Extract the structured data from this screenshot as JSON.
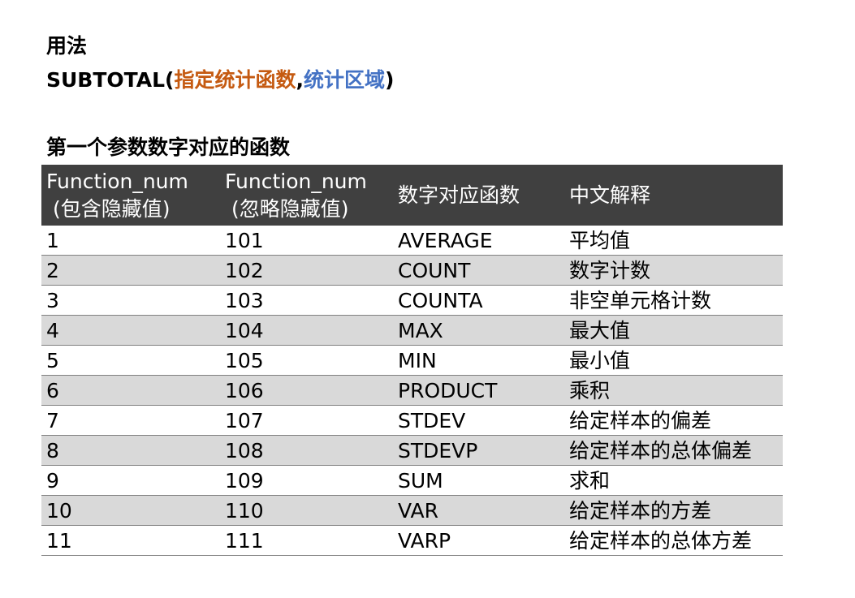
{
  "usage_heading": "用法",
  "syntax": {
    "func_name": "SUBTOTAL(",
    "arg1": "指定统计函数",
    "separator": ",",
    "arg2": "统计区域",
    "close": ")",
    "colors": {
      "arg1": "#C55A11",
      "arg2": "#4472C4"
    }
  },
  "section_title": "第一个参数数字对应的函数",
  "table": {
    "header_bg": "#404040",
    "alt_row_bg": "#D9D9D9",
    "columns": [
      {
        "line1": "Function_num",
        "line2": "(包含隐藏值)"
      },
      {
        "line1": "Function_num",
        "line2": "(忽略隐藏值)"
      },
      {
        "line1": "数字对应函数"
      },
      {
        "line1": "中文解释"
      }
    ],
    "rows": [
      {
        "num_incl": "1",
        "num_excl": "101",
        "func": "AVERAGE",
        "desc": "平均值"
      },
      {
        "num_incl": "2",
        "num_excl": "102",
        "func": "COUNT",
        "desc": "数字计数"
      },
      {
        "num_incl": "3",
        "num_excl": "103",
        "func": "COUNTA",
        "desc": "非空单元格计数"
      },
      {
        "num_incl": "4",
        "num_excl": "104",
        "func": "MAX",
        "desc": "最大值"
      },
      {
        "num_incl": "5",
        "num_excl": "105",
        "func": "MIN",
        "desc": "最小值"
      },
      {
        "num_incl": "6",
        "num_excl": "106",
        "func": "PRODUCT",
        "desc": "乘积"
      },
      {
        "num_incl": "7",
        "num_excl": "107",
        "func": "STDEV",
        "desc": "给定样本的偏差"
      },
      {
        "num_incl": "8",
        "num_excl": "108",
        "func": "STDEVP",
        "desc": "给定样本的总体偏差"
      },
      {
        "num_incl": "9",
        "num_excl": "109",
        "func": "SUM",
        "desc": "求和"
      },
      {
        "num_incl": "10",
        "num_excl": "110",
        "func": "VAR",
        "desc": "给定样本的方差"
      },
      {
        "num_incl": "11",
        "num_excl": "111",
        "func": "VARP",
        "desc": "给定样本的总体方差"
      }
    ]
  }
}
